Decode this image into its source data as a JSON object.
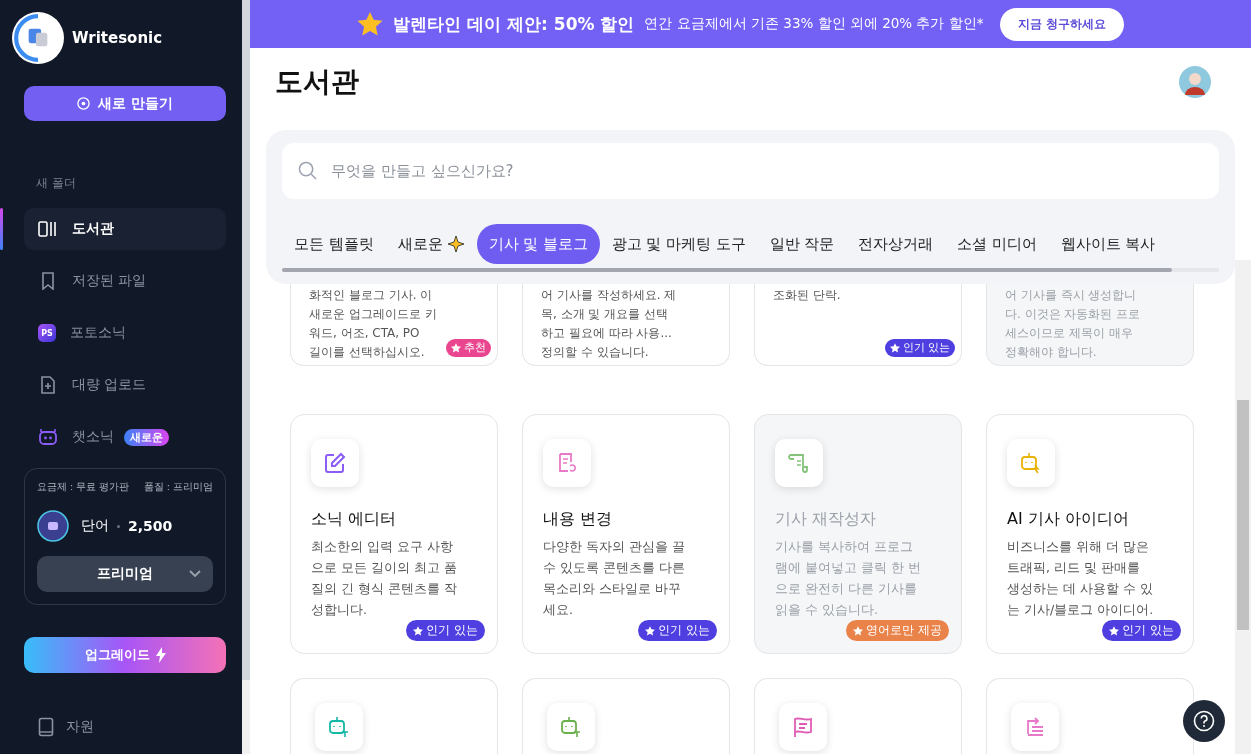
{
  "sidebar": {
    "brand": "Writesonic",
    "new_button": "새로 만들기",
    "folder_label": "새 폴더",
    "items": [
      {
        "kind": "library",
        "label": "도서관",
        "selected": true
      },
      {
        "kind": "bookmark",
        "label": "저장된 파일",
        "selected": false
      },
      {
        "kind": "ps",
        "icon_text": "PS",
        "label": "포토소닉",
        "selected": false
      },
      {
        "kind": "upload",
        "label": "대량 업로드",
        "selected": false
      },
      {
        "kind": "bot",
        "label": "챗소닉",
        "badge": "새로운",
        "selected": false
      }
    ],
    "plan": {
      "plan_label": "요금제 : 무료 평가판",
      "quality_label": "품질 : 프리미엄",
      "words_label": "단어",
      "words_count": "2,500",
      "quality_select": "프리미엄"
    },
    "upgrade_button": "업그레이드",
    "bottom_item": "자원"
  },
  "banner": {
    "title": "발렌타인 데이 제안: 50% 할인",
    "text": "연간 요금제에서 기존 33% 할인 외에 20% 추가 할인*",
    "button": "지금 청구하세요"
  },
  "page_title": "도서관",
  "search": {
    "placeholder": "무엇을 만들고 싶으신가요?"
  },
  "tabs": [
    {
      "label": "모든 템플릿",
      "sparkle": false,
      "selected": false
    },
    {
      "label": "새로운",
      "sparkle": true,
      "selected": false
    },
    {
      "label": "기사 및 블로그",
      "sparkle": false,
      "selected": true
    },
    {
      "label": "광고 및 마케팅 도구",
      "sparkle": false,
      "selected": false
    },
    {
      "label": "일반 작문",
      "sparkle": false,
      "selected": false
    },
    {
      "label": "전자상거래",
      "sparkle": false,
      "selected": false
    },
    {
      "label": "소셜 미디어",
      "sparkle": false,
      "selected": false
    },
    {
      "label": "웹사이트 복사",
      "sparkle": false,
      "selected": false
    }
  ],
  "cards_partial": [
    {
      "description": "화적인 블로그 기사. 이\n새로운 업그레이드로 키\n워드, 어조, CTA, PO\n길이를 선택하십시오.",
      "disabled": false,
      "badge": {
        "kind": "recommended",
        "text": "추천"
      }
    },
    {
      "description": "어 기사를 작성하세요. 제\n목, 소개 및 개요를 선택\n하고 필요에 따라 사용...\n정의할 수 있습니다.",
      "disabled": false
    },
    {
      "description": "조화된 단락.",
      "disabled": false,
      "badge": {
        "kind": "popular",
        "text": "인기 있는"
      }
    },
    {
      "description": "어 기사를 즉시 생성합니\n다. 이것은 자동화된 프로\n세스이므로 제목이 매우\n정확해야 합니다.",
      "disabled": true
    }
  ],
  "cards": [
    {
      "kind": "edit",
      "color": "#8b5cf6",
      "title": "소닉 에디터",
      "description": "최소한의 입력 요구 사항\n으로 모든 길이의 최고 품\n질의 긴 형식 콘텐츠를 작\n성합니다.",
      "disabled": false,
      "badge": {
        "kind": "popular",
        "text": "인기 있는"
      }
    },
    {
      "kind": "doc",
      "color": "#e879c9",
      "title": "내용 변경",
      "description": "다양한 독자의 관심을 끌\n수 있도록 콘텐츠를 다른\n목소리와 스타일로 바꾸\n세요.",
      "disabled": false,
      "badge": {
        "kind": "popular",
        "text": "인기 있는"
      }
    },
    {
      "kind": "scroll",
      "color": "#84c27a",
      "title": "기사 재작성자",
      "description": "기사를 복사하여 프로그\n램에 붙여넣고 클릭 한 번\n으로 완전히 다른 기사를\n읽을 수 있습니다.",
      "disabled": true,
      "badge": {
        "kind": "english",
        "text": "영어로만 제공"
      }
    },
    {
      "kind": "bot",
      "color": "#eab308",
      "title": "AI 기사 아이디어",
      "description": "비즈니스를 위해 더 많은\n트래픽, 리드 및 판매를\n생성하는 데 사용할 수 있\n는 기사/블로그 아이디어.",
      "disabled": false,
      "badge": {
        "kind": "popular",
        "text": "인기 있는"
      }
    }
  ],
  "cards_bottom": [
    {
      "kind": "bot",
      "color": "#14b8a6"
    },
    {
      "kind": "bot",
      "color": "#6ab04c"
    },
    {
      "kind": "flag",
      "color": "#e05bb5"
    },
    {
      "kind": "list",
      "color": "#e879c9"
    }
  ]
}
